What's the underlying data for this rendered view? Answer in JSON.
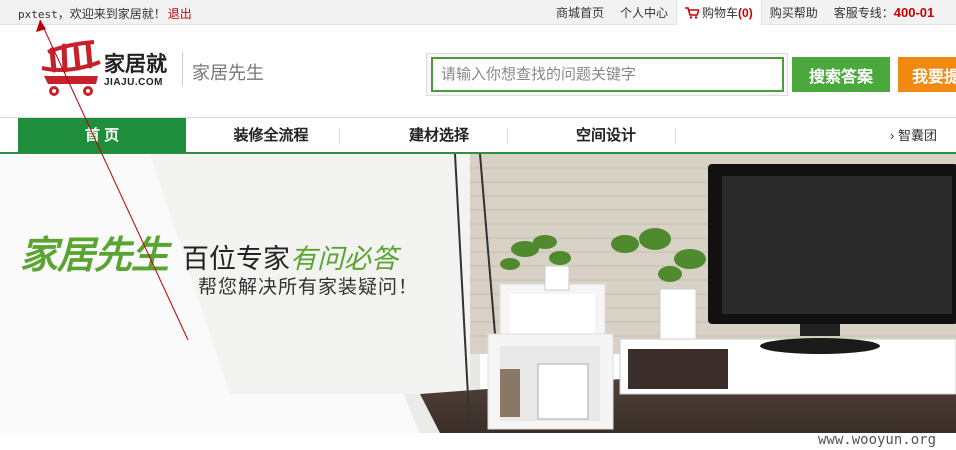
{
  "topbar": {
    "user": "pxtest",
    "welcome": "，欢迎来到家居就！",
    "logout": "退出",
    "links": {
      "mall_home": "商城首页",
      "personal_center": "个人中心",
      "cart": "购物车",
      "cart_count": "(0)",
      "buy_help": "购买帮助",
      "hotline_label": "客服专线：",
      "hotline_number": "400-01"
    }
  },
  "header": {
    "logo_text": "家居就",
    "logo_sub": "JIAJU.COM",
    "site_name": "家居先生",
    "search_placeholder": "请输入你想查找的问题关键字",
    "search_button": "搜索答案",
    "ask_button": "我要提问"
  },
  "nav": {
    "items": [
      "首 页",
      "装修全流程",
      "建材选择",
      "空间设计"
    ],
    "extra": "› 智囊团"
  },
  "banner": {
    "title_green": "家居先生",
    "title_black": "百位专家",
    "title_green2": "有问必答",
    "subtitle": "帮您解决所有家装疑问！"
  },
  "watermark": "www.wooyun.org",
  "colors": {
    "brand_green": "#1f8e3c",
    "search_green": "#4aa83c",
    "ask_orange": "#f08a10",
    "logo_red": "#c8202a"
  },
  "icons": {
    "cart": "shopping-cart-icon",
    "logo": "cart-logo-icon"
  }
}
